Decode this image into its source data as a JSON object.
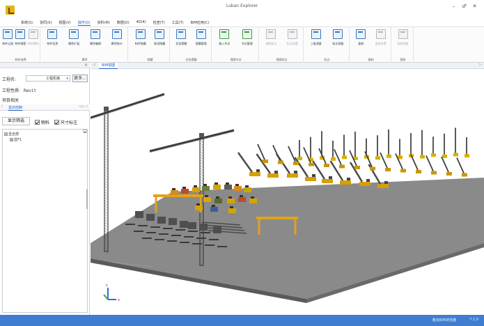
{
  "window": {
    "title": "Luban Explorer",
    "controls": [
      "–",
      "♂",
      "✕"
    ]
  },
  "menu": [
    {
      "label": "系统(S)",
      "active": false
    },
    {
      "label": "协同(X)",
      "active": false
    },
    {
      "label": "视图(V)",
      "active": false
    },
    {
      "label": "操作(O)",
      "active": true
    },
    {
      "label": "资料(M)",
      "active": false
    },
    {
      "label": "数据(D)",
      "active": false
    },
    {
      "label": "4D(4)",
      "active": false
    },
    {
      "label": "检查(T)",
      "active": false
    },
    {
      "label": "工具(T)",
      "active": false
    },
    {
      "label": "BIM应用(C)",
      "active": false
    }
  ],
  "ribbon": {
    "groups": [
      {
        "label": "构件选择",
        "buttons": [
          {
            "label": "构件过滤",
            "icon": "filter-icon",
            "style": ""
          },
          {
            "label": "构件搜索",
            "icon": "search-icon",
            "style": ""
          },
          {
            "label": "构件属性",
            "icon": "properties-icon",
            "style": "gray"
          }
        ]
      },
      {
        "label": "属性",
        "buttons": [
          {
            "label": "构件信息",
            "icon": "info-icon",
            "style": ""
          },
          {
            "label": "属性扩展",
            "icon": "extend-icon",
            "style": ""
          },
          {
            "label": "属性编辑",
            "icon": "edit-icon",
            "style": ""
          },
          {
            "label": "属性统计",
            "icon": "stats-icon",
            "style": ""
          }
        ]
      },
      {
        "label": "隐藏",
        "buttons": [
          {
            "label": "构件隐藏",
            "icon": "hide-icon",
            "style": ""
          },
          {
            "label": "取消隐藏",
            "icon": "unhide-icon",
            "style": ""
          }
        ]
      },
      {
        "label": "任务提醒",
        "buttons": [
          {
            "label": "任务提醒",
            "icon": "bell-icon",
            "style": ""
          },
          {
            "label": "提醒管理",
            "icon": "bookmark-icon",
            "style": ""
          }
        ]
      },
      {
        "label": "视图节点",
        "buttons": [
          {
            "label": "插入节点",
            "icon": "insert-node-icon",
            "style": "green"
          },
          {
            "label": "节点管理",
            "icon": "manage-node-icon",
            "style": "green"
          }
        ]
      },
      {
        "label": "视图标注",
        "buttons": [
          {
            "label": "视图标注",
            "icon": "annotate-icon",
            "style": "gray"
          },
          {
            "label": "标注设置",
            "icon": "annotate-settings-icon",
            "style": "gray"
          }
        ]
      },
      {
        "label": "标注",
        "buttons": [
          {
            "label": "三维测量",
            "icon": "measure-icon",
            "style": ""
          },
          {
            "label": "标注测量",
            "icon": "dim-measure-icon",
            "style": ""
          }
        ]
      },
      {
        "label": "复制",
        "buttons": [
          {
            "label": "复制",
            "icon": "copy-icon",
            "style": ""
          },
          {
            "label": "复制设置",
            "icon": "copy-settings-icon",
            "style": "gray"
          }
        ]
      },
      {
        "label": "图纸",
        "buttons": [
          {
            "label": "图纸框架",
            "icon": "drawing-icon",
            "style": "gray"
          }
        ]
      }
    ]
  },
  "left_panel": {
    "close": "×",
    "project_label": "工程名:",
    "project_value": "工程机械",
    "more_label": "更多...",
    "property_label": "工程性质:",
    "property_value": "Revit",
    "related_label": "项目相关",
    "tab_label": "显示控制",
    "tab_nav_left": "⟨",
    "tab_nav_right": "◁ ▷ ⟩",
    "filter_button": "显示筛选",
    "checkbox_entity": "物料",
    "checkbox_dimension": "尺寸标注",
    "tree": [
      {
        "label": "显全部",
        "expander": "⊟"
      },
      {
        "label": "显F1",
        "expander": "⊞"
      }
    ]
  },
  "viewport": {
    "tab_label": "BIM视图",
    "nav_left": "◁",
    "nav_right": "▷"
  },
  "status": {
    "link": "鲁班BIM浏览器",
    "version": "7.1.0"
  }
}
